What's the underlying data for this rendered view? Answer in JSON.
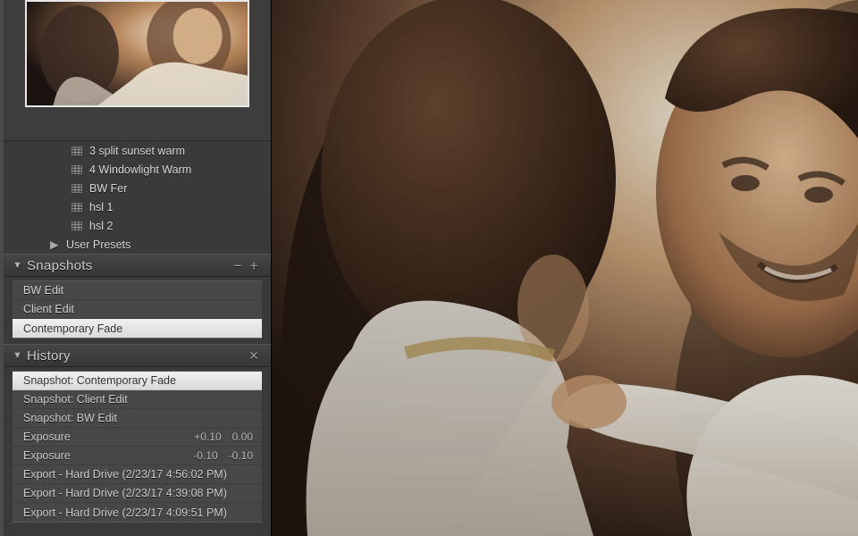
{
  "presets": {
    "items": [
      "3 split sunset warm",
      "4 Windowlight Warm",
      "BW Fer",
      "hsl 1",
      "hsl 2"
    ],
    "folder_label": "User Presets"
  },
  "snapshots": {
    "title": "Snapshots",
    "items": [
      {
        "label": "BW Edit",
        "selected": false
      },
      {
        "label": "Client Edit",
        "selected": false
      },
      {
        "label": "Contemporary Fade",
        "selected": true
      }
    ]
  },
  "history": {
    "title": "History",
    "items": [
      {
        "label": "Snapshot: Contemporary Fade",
        "v1": "",
        "v2": "",
        "selected": true
      },
      {
        "label": "Snapshot: Client Edit",
        "v1": "",
        "v2": "",
        "selected": false
      },
      {
        "label": "Snapshot: BW Edit",
        "v1": "",
        "v2": "",
        "selected": false
      },
      {
        "label": "Exposure",
        "v1": "+0.10",
        "v2": "0.00",
        "selected": false
      },
      {
        "label": "Exposure",
        "v1": "-0.10",
        "v2": "-0.10",
        "selected": false
      },
      {
        "label": "Export - Hard Drive (2/23/17 4:56:02 PM)",
        "v1": "",
        "v2": "",
        "selected": false
      },
      {
        "label": "Export - Hard Drive (2/23/17 4:39:08 PM)",
        "v1": "",
        "v2": "",
        "selected": false
      },
      {
        "label": "Export - Hard Drive (2/23/17 4:09:51 PM)",
        "v1": "",
        "v2": "",
        "selected": false
      }
    ]
  },
  "icons": {
    "triangle_down": "▼",
    "triangle_right": "▶",
    "minus": "−",
    "plus": "+",
    "close": "✕"
  }
}
